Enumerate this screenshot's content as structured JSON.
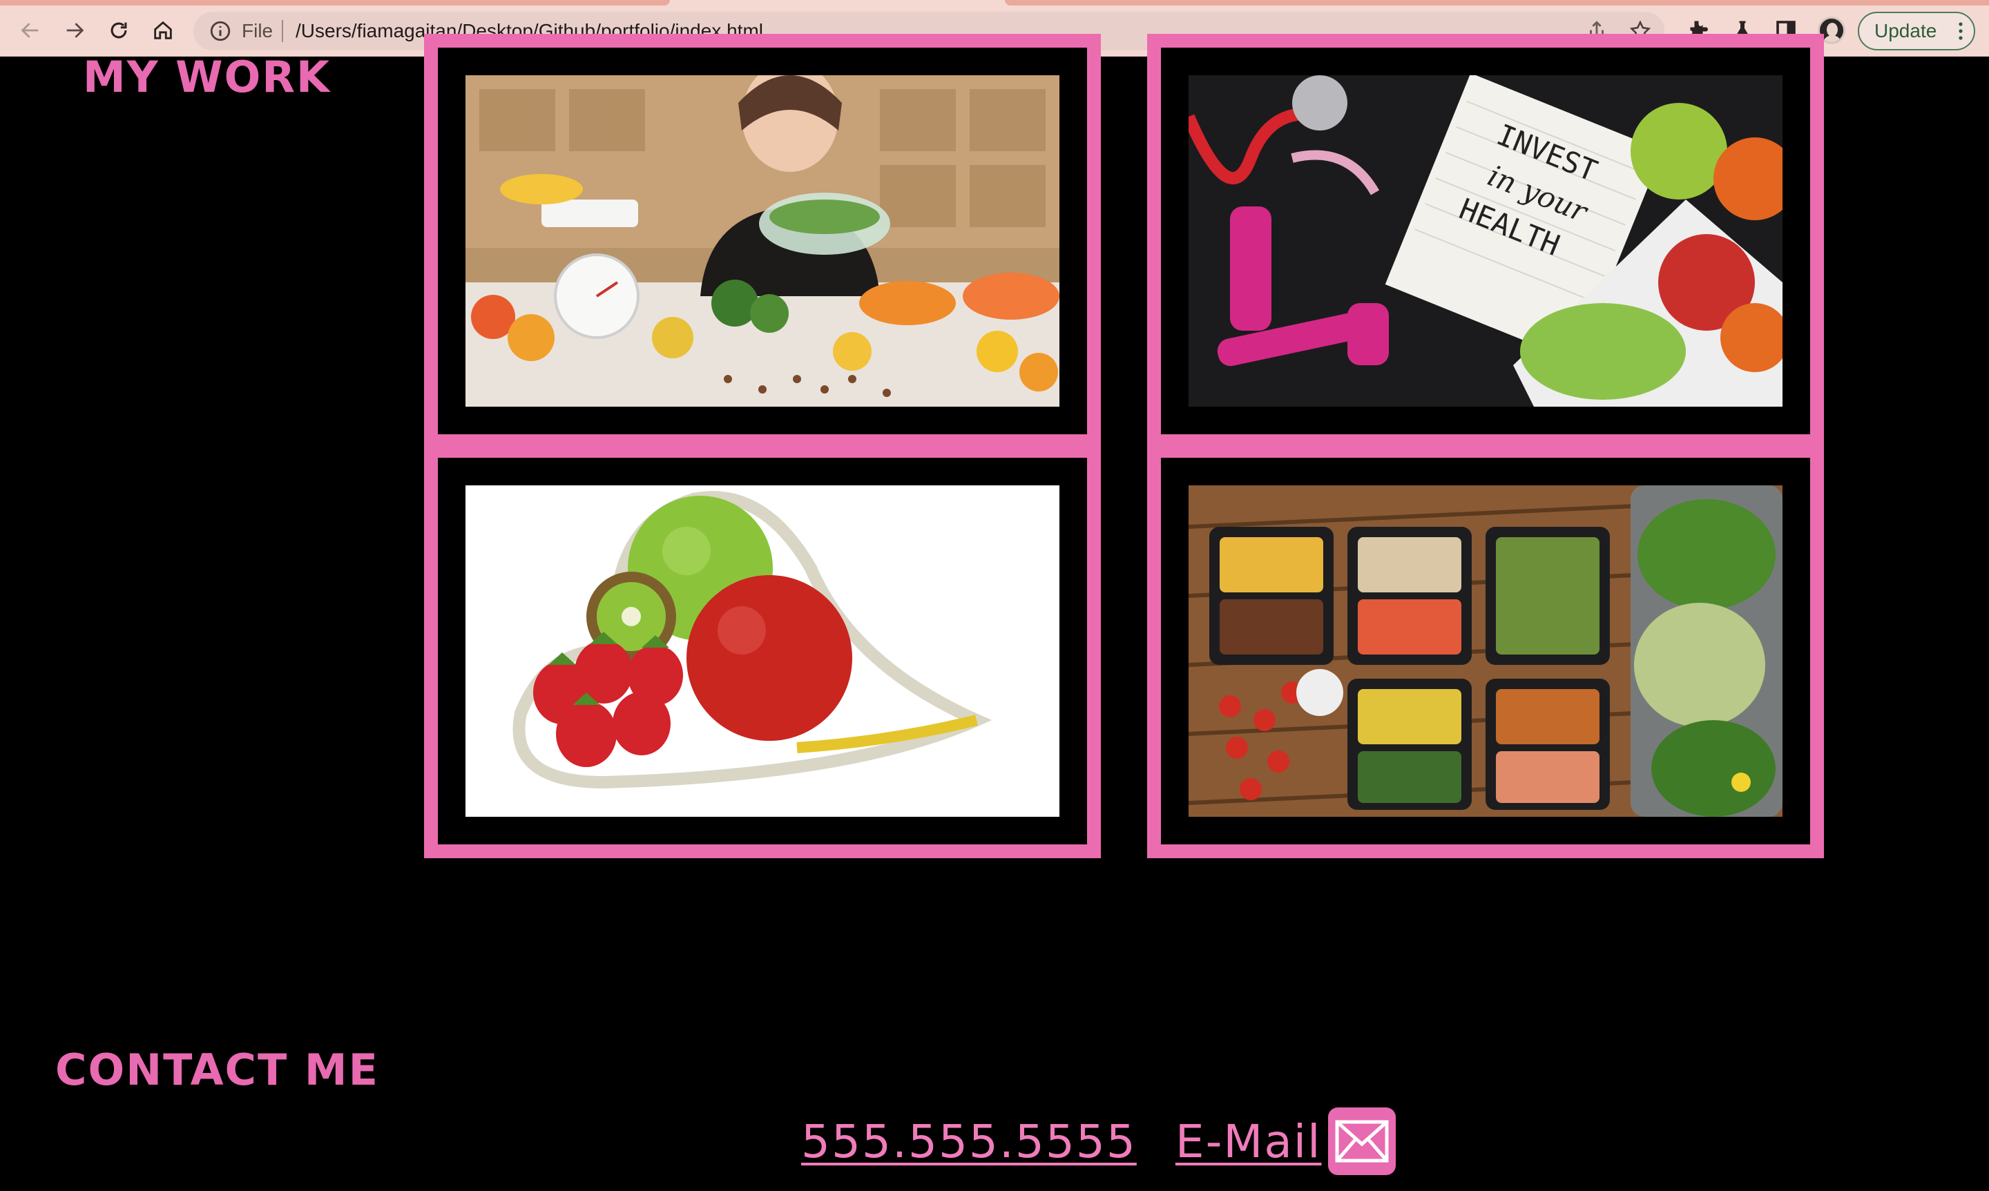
{
  "browser": {
    "scheme_label": "File",
    "url": "/Users/fiamagaitan/Desktop/Github/portfolio/index.html",
    "update_label": "Update",
    "icons": [
      "back-arrow-icon",
      "forward-arrow-icon",
      "reload-icon",
      "home-icon",
      "info-icon",
      "share-icon",
      "star-icon",
      "extensions-icon",
      "lab-flask-icon",
      "side-panel-icon",
      "profile-avatar",
      "more-vert-icon"
    ]
  },
  "sections": {
    "work_heading": "MY WORK",
    "contact_heading": "CONTACT ME"
  },
  "work_cards": [
    {
      "image": "woman-eating-salad-with-fruit"
    },
    {
      "image": "invest-in-your-health-notebook-dumbbells",
      "image_text": "INVEST in your HEALTH"
    },
    {
      "image": "fruit-with-measuring-tape-heart"
    },
    {
      "image": "meal-prep-containers-with-greens"
    }
  ],
  "contact": {
    "phone": "555.555.5555",
    "email_label": "E-Mail",
    "email_icon": "envelope-icon"
  },
  "colors": {
    "accent_pink": "#ec6cb0",
    "background": "#000000",
    "chrome": "#f4d9d3"
  }
}
